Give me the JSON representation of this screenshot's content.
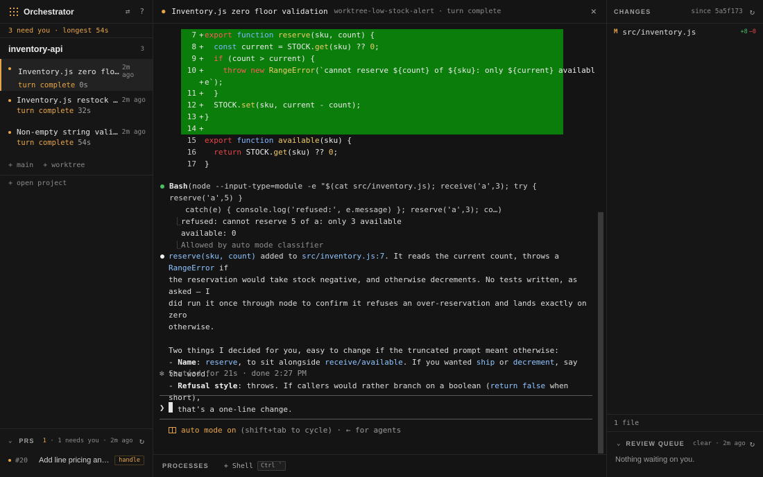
{
  "sidebar": {
    "title": "Orchestrator",
    "attention": "3 need you · longest 54s",
    "project": {
      "name": "inventory-api",
      "count": "3"
    },
    "sessions": [
      {
        "title": "Inventory.js zero floor validation",
        "ago": "2m ago",
        "status": "turn complete",
        "duration": "0s"
      },
      {
        "title": "Inventory.js restock command",
        "ago": "2m ago",
        "status": "turn complete",
        "duration": "32s"
      },
      {
        "title": "Non-empty string validation",
        "ago": "2m ago",
        "status": "turn complete",
        "duration": "54s"
      }
    ],
    "links": {
      "main": "+ main",
      "worktree": "+ worktree"
    },
    "open_project": "+ open project",
    "prs": {
      "label": "PRS",
      "info_count": "1",
      "info_rest": "· 1 needs you · 2m ago",
      "items": [
        {
          "number": "#20",
          "title": "Add line pricing and totals",
          "badge": "handle"
        }
      ]
    }
  },
  "main": {
    "title": "Inventory.js zero floor validation",
    "branch": "worktree-low-stock-alert",
    "separator": "·",
    "state": "turn complete",
    "diff": {
      "lines": [
        {
          "n": "7",
          "sign": "+",
          "added": true,
          "parts": [
            [
              "kw",
              "export"
            ],
            [
              "tx",
              " "
            ],
            [
              "fn",
              "function"
            ],
            [
              "tx",
              " "
            ],
            [
              "nm",
              "reserve"
            ],
            [
              "tx",
              "(sku, count) {"
            ]
          ]
        },
        {
          "n": "8",
          "sign": "+",
          "added": true,
          "parts": [
            [
              "tx",
              "  "
            ],
            [
              "fn",
              "const"
            ],
            [
              "tx",
              " current = STOCK."
            ],
            [
              "nm",
              "get"
            ],
            [
              "tx",
              "(sku) ?? "
            ],
            [
              "nm",
              "0"
            ],
            [
              "tx",
              ";"
            ]
          ]
        },
        {
          "n": "9",
          "sign": "+",
          "added": true,
          "parts": [
            [
              "tx",
              "  "
            ],
            [
              "kw",
              "if"
            ],
            [
              "tx",
              " (count > current) {"
            ]
          ]
        },
        {
          "n": "10",
          "sign": "+",
          "added": true,
          "parts": [
            [
              "tx",
              "    "
            ],
            [
              "kw",
              "throw"
            ],
            [
              "tx",
              " "
            ],
            [
              "kw",
              "new"
            ],
            [
              "tx",
              " "
            ],
            [
              "nm",
              "RangeError"
            ],
            [
              "tx",
              "(`cannot reserve ${count} of ${sku}: only ${current} availabl"
            ]
          ]
        },
        {
          "n": "",
          "sign": "+",
          "added": true,
          "wrap": true,
          "parts": [
            [
              "tx",
              "e`);"
            ]
          ]
        },
        {
          "n": "11",
          "sign": "+",
          "added": true,
          "parts": [
            [
              "tx",
              "  }"
            ]
          ]
        },
        {
          "n": "12",
          "sign": "+",
          "added": true,
          "parts": [
            [
              "tx",
              "  STOCK."
            ],
            [
              "nm",
              "set"
            ],
            [
              "tx",
              "(sku, current - count);"
            ]
          ]
        },
        {
          "n": "13",
          "sign": "+",
          "added": true,
          "parts": [
            [
              "tx",
              "}"
            ]
          ]
        },
        {
          "n": "14",
          "sign": "+",
          "added": true,
          "parts": [
            [
              "tx",
              ""
            ]
          ]
        },
        {
          "n": "15",
          "sign": "",
          "added": false,
          "parts": [
            [
              "kw",
              "export"
            ],
            [
              "tx",
              " "
            ],
            [
              "fn",
              "function"
            ],
            [
              "tx",
              " "
            ],
            [
              "nm",
              "available"
            ],
            [
              "tx",
              "(sku) {"
            ]
          ]
        },
        {
          "n": "16",
          "sign": "",
          "added": false,
          "parts": [
            [
              "tx",
              "  "
            ],
            [
              "kw",
              "return"
            ],
            [
              "tx",
              " STOCK."
            ],
            [
              "nm",
              "get"
            ],
            [
              "tx",
              "(sku) ?? "
            ],
            [
              "nm",
              "0"
            ],
            [
              "tx",
              ";"
            ]
          ]
        },
        {
          "n": "17",
          "sign": "",
          "added": false,
          "parts": [
            [
              "tx",
              "}"
            ]
          ]
        }
      ]
    },
    "bash": {
      "tool": "Bash",
      "cmd_line1": "(node --input-type=module -e \"$(cat src/inventory.js); receive('a',3); try { reserve('a',5) }",
      "cmd_line2": "catch(e) { console.log('refused:', e.message) }; reserve('a',3); co…)",
      "elbow": "⎿",
      "out1": "refused: cannot reserve 5 of a: only 3 available",
      "out2": "available: 0",
      "allowed": "Allowed by auto mode classifier"
    },
    "message": {
      "p1_fn": "reserve(sku, count)",
      "p1_a": " added to ",
      "p1_file": "src/inventory.js:7",
      "p1_b": ". It reads the current count, throws a ",
      "p1_err": "RangeError",
      "p1_c": " if",
      "p1_l2": "the reservation would take stock negative, and otherwise decrements. No tests written, as asked — I",
      "p1_l3": "did run it once through node to confirm it refuses an over-reservation and lands exactly on zero",
      "p1_l4": "otherwise.",
      "p2": "Two things I decided for you, easy to change if the truncated prompt meant otherwise:",
      "b1_dash": "- ",
      "b1_key": "Name",
      "b1_a": ": ",
      "b1_fn": "reserve",
      "b1_b": ", to sit alongside ",
      "b1_fn2": "receive/available",
      "b1_c": ". If you wanted ",
      "b1_fn3": "ship",
      "b1_d": " or ",
      "b1_fn4": "decrement",
      "b1_e": ", say the word.",
      "b2_dash": "- ",
      "b2_key": "Refusal style",
      "b2_a": ": throws. If callers would rather branch on a boolean (",
      "b2_code": "return false",
      "b2_b": " when short),",
      "b2_l2": "that's a one-line change."
    },
    "sauteed": "✻ Sautéed for 21s · done 2:27 PM",
    "prompt_symbol": "❯",
    "mode": {
      "on": "auto mode on",
      "hint": "(shift+tab to cycle) · ← for agents"
    },
    "processes": {
      "label": "PROCESSES",
      "shell": "+ Shell",
      "kbd": "Ctrl `"
    }
  },
  "right": {
    "changes_label": "CHANGES",
    "since": "since 5a5f173",
    "files": [
      {
        "status": "M",
        "name": "src/inventory.js",
        "add": "+8",
        "del": "−0"
      }
    ],
    "file_count": "1 file",
    "review": {
      "label": "REVIEW QUEUE",
      "meta": "clear · 2m ago",
      "empty": "Nothing waiting on you."
    }
  },
  "colors": {
    "accent": "#e8a547",
    "added_bg": "#0a7d0a",
    "success": "#4dbf63",
    "danger": "#e84646"
  }
}
